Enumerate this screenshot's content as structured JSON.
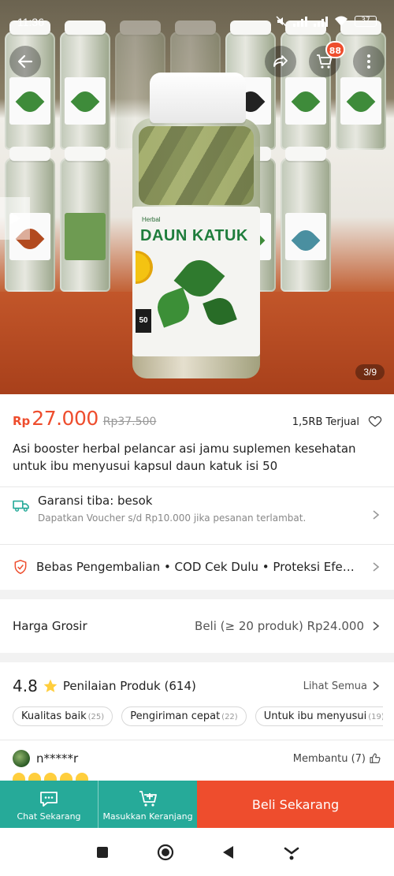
{
  "status_bar": {
    "time": "11:36",
    "battery": "37"
  },
  "product_image": {
    "label_title": "DAUN KATUK",
    "label_brand": "Herbal",
    "label_count": "50",
    "counter": "3/9"
  },
  "toolbar": {
    "cart_count": "88"
  },
  "price": {
    "currency": "Rp",
    "current": "27.000",
    "original": "Rp37.500",
    "sold": "1,5RB Terjual"
  },
  "product": {
    "title": "Asi booster herbal pelancar asi jamu suplemen kesehatan untuk ibu menyusui kapsul daun katuk isi 50"
  },
  "shipping": {
    "label": "Garansi tiba: besok",
    "sub": "Dapatkan Voucher s/d Rp10.000 jika pesanan terlambat."
  },
  "guarantees": {
    "text": "Bebas Pengembalian  •  COD Cek Dulu  •  Proteksi Efe…"
  },
  "wholesale": {
    "label": "Harga Grosir",
    "value": "Beli (≥ 20 produk) Rp24.000"
  },
  "reviews": {
    "score": "4.8",
    "title": "Penilaian Produk (614)",
    "see_all": "Lihat Semua",
    "chips": [
      {
        "label": "Kualitas baik",
        "count": "(25)"
      },
      {
        "label": "Pengiriman cepat",
        "count": "(22)"
      },
      {
        "label": "Untuk ibu menyusui",
        "count": "(19)"
      }
    ],
    "reviewer": "n*****r",
    "helpful": "Membantu (7)"
  },
  "actions": {
    "chat": "Chat Sekarang",
    "add_cart": "Masukkan Keranjang",
    "buy": "Beli Sekarang"
  },
  "colors": {
    "accent": "#ee4d2d",
    "teal": "#26aa99",
    "star": "#ffce3d"
  }
}
